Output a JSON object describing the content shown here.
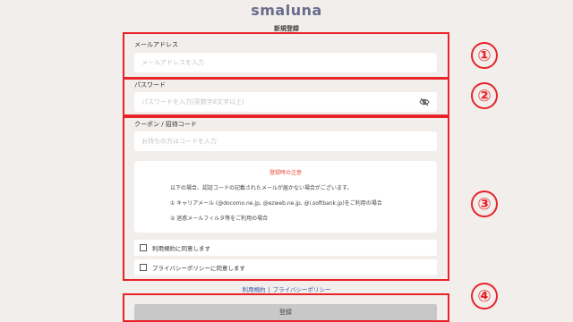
{
  "app": {
    "logo": "smaluna",
    "title": "新規登録"
  },
  "email": {
    "label": "メールアドレス",
    "placeholder": "メールアドレスを入力"
  },
  "password": {
    "label": "パスワード",
    "placeholder": "パスワードを入力(英数字8文字以上)",
    "toggle_icon": "eye-off-icon"
  },
  "coupon": {
    "label": "クーポン / 招待コード",
    "placeholder": "お持ちの方はコードを入力"
  },
  "notice": {
    "title": "登録時の注意",
    "line1": "以下の場合、認証コードの記載されたメールが届かない場合がございます。",
    "line2": "① キャリアメール (@docomo.ne.jp, @ezweb.ne.jp, @i.softbank.jp)をご利用の場合",
    "line3": "② 迷惑メールフィルタ等をご利用の場合"
  },
  "agreements": {
    "terms": "利用規約に同意します",
    "privacy": "プライバシーポリシーに同意します"
  },
  "footer": {
    "terms_link": "利用規約",
    "separator": "|",
    "privacy_link": "プライバシーポリシー"
  },
  "submit_label": "登録",
  "annotations": {
    "n1": "①",
    "n2": "②",
    "n3": "③",
    "n4": "④"
  },
  "colors": {
    "highlight": "#e8232a",
    "link": "#3b56a8",
    "notice_title": "#e8472f",
    "logo": "#6a6c8c"
  }
}
